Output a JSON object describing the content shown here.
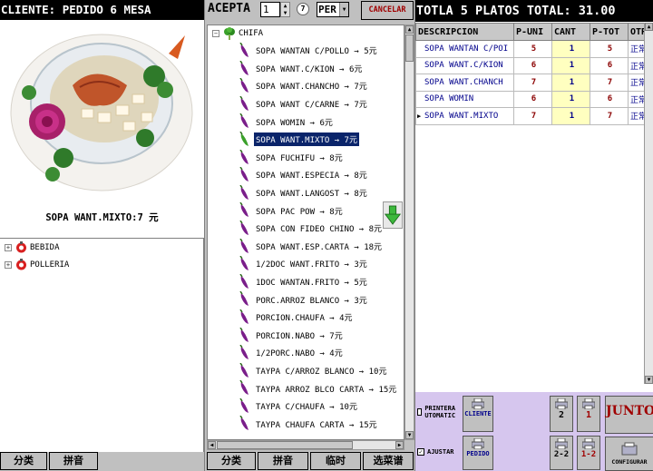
{
  "left": {
    "header": "CLIENTE: PEDIDO  6 MESA",
    "dish_caption": "SOPA WANT.MIXTO:7 元",
    "categories": [
      {
        "label": "BEBIDA"
      },
      {
        "label": "POLLERIA"
      }
    ],
    "tabs": [
      "分类",
      "拼音"
    ]
  },
  "mid": {
    "acepta_label": "ACEPTA",
    "quantity": "1",
    "seven_label": "7",
    "per_value": "PER",
    "cancel_label": "CANCELAR",
    "root_label": "CHIFA",
    "items": [
      {
        "label": "SOPA WANTAN C/POLLO → 5元",
        "selected": false
      },
      {
        "label": "SOPA WANT.C/KION → 6元",
        "selected": false
      },
      {
        "label": "SOPA WANT.CHANCHO → 7元",
        "selected": false
      },
      {
        "label": "SOPA WANT C/CARNE → 7元",
        "selected": false
      },
      {
        "label": "SOPA WOMIN → 6元",
        "selected": false
      },
      {
        "label": "SOPA WANT.MIXTO → 7元",
        "selected": true
      },
      {
        "label": "SOPA FUCHIFU → 8元",
        "selected": false
      },
      {
        "label": "SOPA WANT.ESPECIA → 8元",
        "selected": false
      },
      {
        "label": "SOPA WANT.LANGOST → 8元",
        "selected": false
      },
      {
        "label": "SOPA PAC POW → 8元",
        "selected": false
      },
      {
        "label": "SOPA CON FIDEO CHINO → 8元",
        "selected": false
      },
      {
        "label": "SOPA WANT.ESP.CARTA → 18元",
        "selected": false
      },
      {
        "label": "1/2DOC WANT.FRITO → 3元",
        "selected": false
      },
      {
        "label": "1DOC WANTAN.FRITO → 5元",
        "selected": false
      },
      {
        "label": "PORC.ARROZ BLANCO → 3元",
        "selected": false
      },
      {
        "label": "PORCION.CHAUFA → 4元",
        "selected": false
      },
      {
        "label": "PORCION.NABO → 7元",
        "selected": false
      },
      {
        "label": "1/2PORC.NABO → 4元",
        "selected": false
      },
      {
        "label": "TAYPA C/ARROZ BLANCO → 10元",
        "selected": false
      },
      {
        "label": "TAYPA ARROZ BLCO CARTA → 15元",
        "selected": false
      },
      {
        "label": "TAYPA C/CHAUFA → 10元",
        "selected": false
      },
      {
        "label": "TAYPA CHAUFA CARTA → 15元",
        "selected": false
      }
    ],
    "tabs": [
      "分类",
      "拼音",
      "临时",
      "选菜谱"
    ]
  },
  "right": {
    "header": "TOTLA 5 PLATOS TOTAL: 31.00",
    "columns": [
      "DESCRIPCION",
      "P-UNI",
      "CANT",
      "P-TOT",
      "OTR"
    ],
    "rows": [
      {
        "desc": "SOPA WANTAN C/POI",
        "puni": "5",
        "cant": "1",
        "ptot": "5",
        "otr": "正常",
        "current": false
      },
      {
        "desc": "SOPA WANT.C/KION",
        "puni": "6",
        "cant": "1",
        "ptot": "6",
        "otr": "正常",
        "current": false
      },
      {
        "desc": "SOPA WANT.CHANCH",
        "puni": "7",
        "cant": "1",
        "ptot": "7",
        "otr": "正常",
        "current": false
      },
      {
        "desc": "SOPA WOMIN",
        "puni": "6",
        "cant": "1",
        "ptot": "6",
        "otr": "正常",
        "current": false
      },
      {
        "desc": "SOPA WANT.MIXTO",
        "puni": "7",
        "cant": "1",
        "ptot": "7",
        "otr": "正常",
        "current": true
      }
    ],
    "controls": {
      "printer_auto_label": "PRINTERA UTOMATIC",
      "ajustar_label": "AJUSTAR",
      "cliente_label": "CLIENTE",
      "pedido_label": "PEDIDO",
      "btn_2": "2",
      "btn_1": "1",
      "btn_2_2": "2-2",
      "btn_1_2": "1-2",
      "junto_label": "JUNTO",
      "configurar_label": "CONFIGURAR",
      "printer_auto_checked": false,
      "ajustar_checked": true
    }
  },
  "colors": {
    "selection": "#0a246a",
    "accent_red": "#a00000",
    "panel_purple": "#d6c6ee",
    "cant_yellow": "#ffffc0"
  }
}
